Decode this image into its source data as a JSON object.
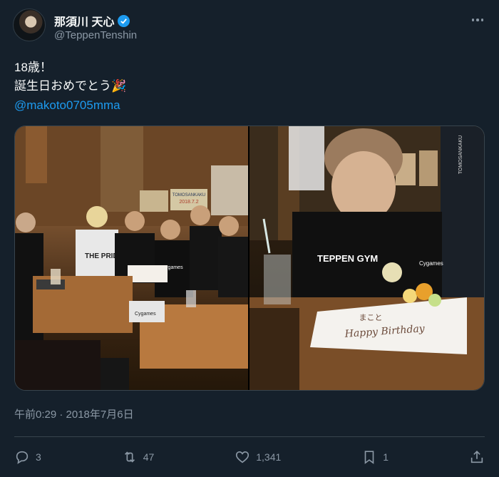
{
  "user": {
    "display_name": "那須川 天心",
    "handle": "@TeppenTenshin",
    "verified_icon": "verified-badge-icon",
    "accent_color": "#1d9bf0"
  },
  "tweet": {
    "line1": "18歳！",
    "line2": "誕生日おめでとう🎉",
    "mention": "@makoto0705mma"
  },
  "media": {
    "left_photo": {
      "shirt_text": "THE PRIDE",
      "shirt_text_2": "Cygames",
      "sign_text": "TOMOSANKAKU",
      "sign_date": "2018.7.2",
      "shorts_text": "Cygames"
    },
    "right_photo": {
      "shirt_text": "TEPPEN GYM",
      "shirt_text_2": "Cygames",
      "plate_text": "Happy Birthday",
      "plate_text_2": "まこと",
      "sign_text": "TOMOSANKAKU"
    }
  },
  "meta": {
    "timestamp": "午前0:29 · 2018年7月6日"
  },
  "actions": {
    "replies": "3",
    "retweets": "47",
    "likes": "1,341",
    "bookmarks": "1"
  }
}
